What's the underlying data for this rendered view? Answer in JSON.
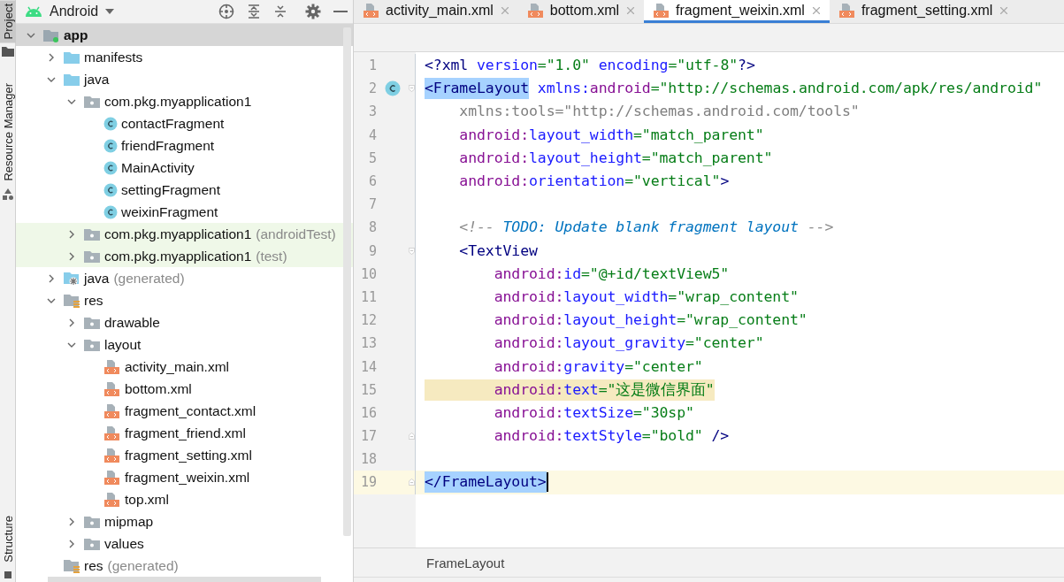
{
  "side_strip": {
    "tabs": [
      {
        "label": "Project",
        "selected": true
      },
      {
        "label": "Resource Manager",
        "selected": false
      }
    ],
    "bottom_tabs": [
      {
        "label": "Structure",
        "selected": false
      }
    ]
  },
  "project_panel": {
    "view": "Android",
    "tree": [
      {
        "label": "app",
        "kind": "module",
        "expanded": true,
        "selected": true,
        "children": [
          {
            "label": "manifests",
            "kind": "folder",
            "expanded": false,
            "selected": false
          },
          {
            "label": "java",
            "kind": "folder",
            "expanded": true,
            "selected": false,
            "children": [
              {
                "label": "com.pkg.myapplication1",
                "kind": "package",
                "expanded": true,
                "selected": false,
                "children": [
                  {
                    "label": "contactFragment",
                    "kind": "class",
                    "selected": false
                  },
                  {
                    "label": "friendFragment",
                    "kind": "class",
                    "selected": false
                  },
                  {
                    "label": "MainActivity",
                    "kind": "class",
                    "selected": false
                  },
                  {
                    "label": "settingFragment",
                    "kind": "class",
                    "selected": false
                  },
                  {
                    "label": "weixinFragment",
                    "kind": "class",
                    "selected": false
                  }
                ]
              },
              {
                "label": "com.pkg.myapplication1",
                "note": "(androidTest)",
                "kind": "package",
                "expanded": false,
                "selected": false,
                "tinted": true
              },
              {
                "label": "com.pkg.myapplication1",
                "note": "(test)",
                "kind": "package",
                "expanded": false,
                "selected": false,
                "tinted": true
              }
            ]
          },
          {
            "label": "java",
            "note": "(generated)",
            "kind": "generated",
            "expanded": false,
            "selected": false
          },
          {
            "label": "res",
            "kind": "res",
            "expanded": true,
            "selected": false,
            "children": [
              {
                "label": "drawable",
                "kind": "package",
                "expanded": false,
                "selected": false
              },
              {
                "label": "layout",
                "kind": "package",
                "expanded": true,
                "selected": false,
                "children": [
                  {
                    "label": "activity_main.xml",
                    "kind": "xml",
                    "selected": false
                  },
                  {
                    "label": "bottom.xml",
                    "kind": "xml",
                    "selected": false
                  },
                  {
                    "label": "fragment_contact.xml",
                    "kind": "xml",
                    "selected": false
                  },
                  {
                    "label": "fragment_friend.xml",
                    "kind": "xml",
                    "selected": false
                  },
                  {
                    "label": "fragment_setting.xml",
                    "kind": "xml",
                    "selected": false
                  },
                  {
                    "label": "fragment_weixin.xml",
                    "kind": "xml",
                    "selected": false
                  },
                  {
                    "label": "top.xml",
                    "kind": "xml",
                    "selected": false
                  }
                ]
              },
              {
                "label": "mipmap",
                "kind": "package",
                "expanded": false,
                "selected": false
              },
              {
                "label": "values",
                "kind": "package",
                "expanded": false,
                "selected": false
              }
            ]
          },
          {
            "label": "res",
            "note": "(generated)",
            "kind": "res",
            "selected": false
          }
        ]
      }
    ]
  },
  "editor_tabs": [
    {
      "label": "activity_main.xml",
      "selected": false
    },
    {
      "label": "bottom.xml",
      "selected": false
    },
    {
      "label": "fragment_weixin.xml",
      "selected": true
    },
    {
      "label": "fragment_setting.xml",
      "selected": false
    }
  ],
  "code": [
    {
      "number": "1",
      "tokens": [
        {
          "kind": "tag",
          "text": "<?xml "
        },
        {
          "kind": "attr",
          "text": "version"
        },
        {
          "kind": "value",
          "text": "=\"1.0\" "
        },
        {
          "kind": "attr",
          "text": "encoding"
        },
        {
          "kind": "value",
          "text": "=\"utf-8\""
        },
        {
          "kind": "tag",
          "text": "?>"
        }
      ]
    },
    {
      "number": "2",
      "gutter_icon": true,
      "fold_start": true,
      "tokens": [
        {
          "kind": "tag",
          "text": "<FrameLayout",
          "selected": true
        },
        {
          "kind": "attr",
          "text": " xmlns:"
        },
        {
          "kind": "ns",
          "text": "android"
        },
        {
          "kind": "value",
          "text": "=\"http://schemas.android.com/apk/res/android\""
        }
      ]
    },
    {
      "number": "3",
      "tokens": [
        {
          "kind": "unused",
          "text": "    xmlns:tools=\"http://schemas.android.com/tools\""
        }
      ]
    },
    {
      "number": "4",
      "tokens": [
        {
          "kind": "ns",
          "text": "    android:"
        },
        {
          "kind": "attr",
          "text": "layout_width"
        },
        {
          "kind": "value",
          "text": "=\"match_parent\""
        }
      ]
    },
    {
      "number": "5",
      "tokens": [
        {
          "kind": "ns",
          "text": "    android:"
        },
        {
          "kind": "attr",
          "text": "layout_height"
        },
        {
          "kind": "value",
          "text": "=\"match_parent\""
        }
      ]
    },
    {
      "number": "6",
      "tokens": [
        {
          "kind": "ns",
          "text": "    android:"
        },
        {
          "kind": "attr",
          "text": "orientation"
        },
        {
          "kind": "value",
          "text": "=\"vertical\""
        },
        {
          "kind": "tag",
          "text": ">"
        }
      ]
    },
    {
      "number": "7"
    },
    {
      "number": "8",
      "tokens": [
        {
          "kind": "comment",
          "text": "    <!-- "
        },
        {
          "kind": "todo",
          "text": "TODO: Update blank fragment layout"
        },
        {
          "kind": "comment",
          "text": " -->"
        }
      ]
    },
    {
      "number": "9",
      "fold_start": true,
      "tokens": [
        {
          "kind": "tag",
          "text": "    <TextView"
        }
      ]
    },
    {
      "number": "10",
      "tokens": [
        {
          "kind": "ns",
          "text": "        android:"
        },
        {
          "kind": "attr",
          "text": "id"
        },
        {
          "kind": "value",
          "text": "=\"@+id/textView5\""
        }
      ]
    },
    {
      "number": "11",
      "tokens": [
        {
          "kind": "ns",
          "text": "        android:"
        },
        {
          "kind": "attr",
          "text": "layout_width"
        },
        {
          "kind": "value",
          "text": "=\"wrap_content\""
        }
      ]
    },
    {
      "number": "12",
      "tokens": [
        {
          "kind": "ns",
          "text": "        android:"
        },
        {
          "kind": "attr",
          "text": "layout_height"
        },
        {
          "kind": "value",
          "text": "=\"wrap_content\""
        }
      ]
    },
    {
      "number": "13",
      "tokens": [
        {
          "kind": "ns",
          "text": "        android:"
        },
        {
          "kind": "attr",
          "text": "layout_gravity"
        },
        {
          "kind": "value",
          "text": "=\"center\""
        }
      ]
    },
    {
      "number": "14",
      "tokens": [
        {
          "kind": "ns",
          "text": "        android:"
        },
        {
          "kind": "attr",
          "text": "gravity"
        },
        {
          "kind": "value",
          "text": "=\"center\""
        }
      ]
    },
    {
      "number": "15",
      "highlighted": true,
      "tokens": [
        {
          "kind": "ns",
          "text": "        android:"
        },
        {
          "kind": "attr",
          "text": "text"
        },
        {
          "kind": "value",
          "text": "=\"这是微信界面\""
        }
      ]
    },
    {
      "number": "16",
      "tokens": [
        {
          "kind": "ns",
          "text": "        android:"
        },
        {
          "kind": "attr",
          "text": "textSize"
        },
        {
          "kind": "value",
          "text": "=\"30sp\""
        }
      ]
    },
    {
      "number": "17",
      "fold_end": true,
      "tokens": [
        {
          "kind": "ns",
          "text": "        android:"
        },
        {
          "kind": "attr",
          "text": "textStyle"
        },
        {
          "kind": "value",
          "text": "=\"bold\" "
        },
        {
          "kind": "tag",
          "text": "/>"
        }
      ]
    },
    {
      "number": "18"
    },
    {
      "number": "19",
      "current": true,
      "caret": true,
      "fold_end": true,
      "tokens": [
        {
          "kind": "tag",
          "text": "</FrameLayout>",
          "selected": true
        }
      ]
    }
  ],
  "breadcrumb": "FrameLayout"
}
